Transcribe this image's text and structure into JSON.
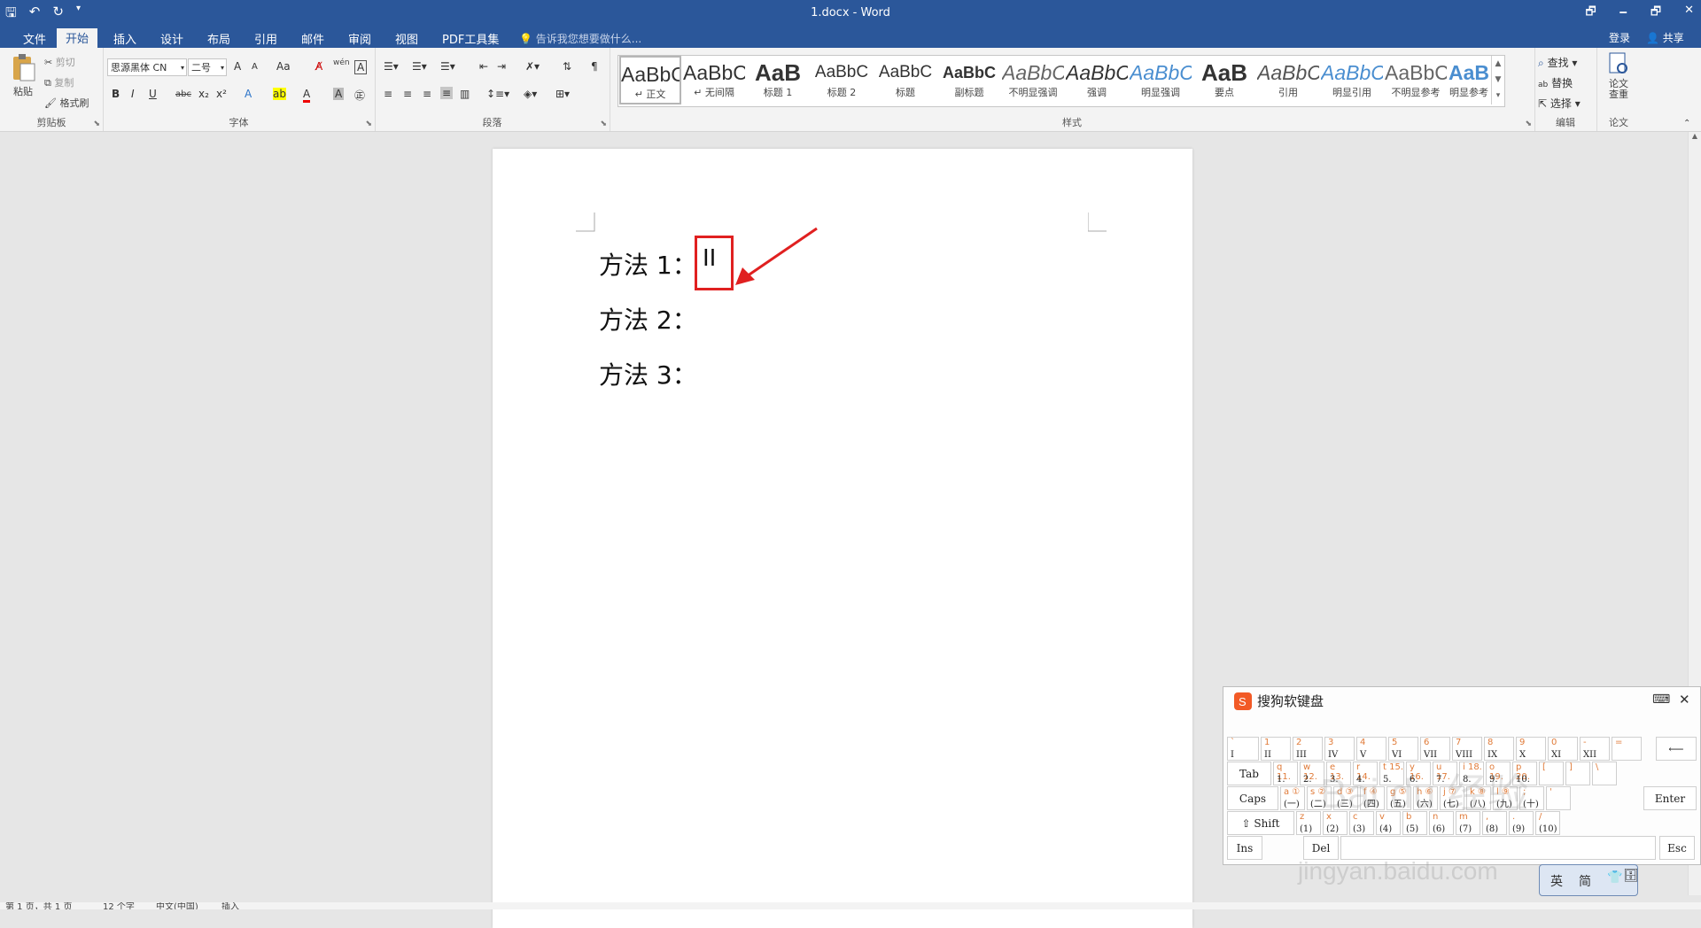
{
  "app": {
    "title": "1.docx - Word"
  },
  "qat": {
    "save": "🖫",
    "undo": "↶",
    "redo": "↻",
    "more": "▾"
  },
  "window": {
    "restore": "🗗",
    "minimize": "🗕",
    "maximize": "🗗",
    "close": "✕"
  },
  "tabs": [
    "文件",
    "开始",
    "插入",
    "设计",
    "布局",
    "引用",
    "邮件",
    "审阅",
    "视图",
    "PDF工具集"
  ],
  "tell_me": "告诉我您想要做什么...",
  "account": {
    "login": "登录",
    "share": "共享"
  },
  "clipboard": {
    "paste": "粘贴",
    "cut": "剪切",
    "copy": "复制",
    "format_painter": "格式刷",
    "label": "剪贴板"
  },
  "font": {
    "name": "思源黑体 CN",
    "size": "二号",
    "label": "字体",
    "bold": "B",
    "italic": "I",
    "underline": "U",
    "strike": "abc",
    "sub": "x₂",
    "sup": "x²",
    "grow": "A",
    "shrink": "A",
    "case": "Aa",
    "phonetic": "wén",
    "char_border": "A"
  },
  "paragraph": {
    "label": "段落"
  },
  "styles": {
    "label": "样式",
    "items": [
      {
        "preview": "AaBbCcDd",
        "label": "↵ 正文"
      },
      {
        "preview": "AaBbCcDd",
        "label": "↵ 无间隔"
      },
      {
        "preview": "AaB",
        "label": "标题 1"
      },
      {
        "preview": "AaBbC",
        "label": "标题 2"
      },
      {
        "preview": "AaBbC",
        "label": "标题"
      },
      {
        "preview": "AaBbC",
        "label": "副标题"
      },
      {
        "preview": "AaBbCcDd",
        "label": "不明显强调"
      },
      {
        "preview": "AaBbCcDd",
        "label": "强调"
      },
      {
        "preview": "AaBbCcDd",
        "label": "明显强调"
      },
      {
        "preview": "AaB",
        "label": "要点"
      },
      {
        "preview": "AaBbCcDd",
        "label": "引用"
      },
      {
        "preview": "AaBbCcDd",
        "label": "明显引用"
      },
      {
        "preview": "AaBbCcDd",
        "label": "不明显参考"
      },
      {
        "preview": "AaBbCcDd",
        "label": "明显参考"
      }
    ]
  },
  "editing": {
    "find": "查找",
    "replace": "替换",
    "select": "选择",
    "label": "编辑"
  },
  "paper": {
    "check": "论文查重",
    "check_line1": "论文",
    "check_line2": "查重",
    "label": "论文"
  },
  "document": {
    "lines": [
      "方法 1：",
      "方法 2：",
      "方法 3："
    ],
    "highlight_text": "II"
  },
  "status": {
    "page": "第 1 页，共 1 页",
    "words": "12 个字",
    "lang": "中文(中国)",
    "mode": "插入"
  },
  "keyboard": {
    "title": "搜狗软键盘",
    "row1": [
      [
        "`",
        "I"
      ],
      [
        "1",
        "II"
      ],
      [
        "2",
        "III"
      ],
      [
        "3",
        "IV"
      ],
      [
        "4",
        "V"
      ],
      [
        "5",
        "VI"
      ],
      [
        "6",
        "VII"
      ],
      [
        "7",
        "VIII"
      ],
      [
        "8",
        "IX"
      ],
      [
        "9",
        "X"
      ],
      [
        "0",
        "XI"
      ],
      [
        "-",
        "XII"
      ],
      [
        "=",
        ""
      ]
    ],
    "row2": [
      [
        "q 11.",
        "1."
      ],
      [
        "w 12.",
        "2."
      ],
      [
        "e 13.",
        "3."
      ],
      [
        "r 14.",
        "4."
      ],
      [
        "t 15.",
        "5."
      ],
      [
        "y 16.",
        "6."
      ],
      [
        "u 17.",
        "7."
      ],
      [
        "i 18.",
        "8."
      ],
      [
        "o 19.",
        "9."
      ],
      [
        "p 20.",
        "10."
      ],
      [
        "[",
        ""
      ],
      [
        "]",
        ""
      ],
      [
        "\\",
        ""
      ]
    ],
    "row3": [
      [
        "a ①",
        "(一)"
      ],
      [
        "s ②",
        "(二)"
      ],
      [
        "d ③",
        "(三)"
      ],
      [
        "f ④",
        "(四)"
      ],
      [
        "g ⑤",
        "(五)"
      ],
      [
        "h ⑥",
        "(六)"
      ],
      [
        "j ⑦",
        "(七)"
      ],
      [
        "k ⑧",
        "(八)"
      ],
      [
        "l ⑨",
        "(九)"
      ],
      [
        ";",
        "(十)"
      ],
      [
        "'",
        ""
      ]
    ],
    "row4": [
      [
        "z",
        "(1)"
      ],
      [
        "x",
        "(2)"
      ],
      [
        "c",
        "(3)"
      ],
      [
        "v",
        "(4)"
      ],
      [
        "b",
        "(5)"
      ],
      [
        "n",
        "(6)"
      ],
      [
        "m",
        "(7)"
      ],
      [
        ",",
        "(8)"
      ],
      [
        ".",
        "(9)"
      ],
      [
        "/",
        "(10)"
      ]
    ],
    "tab": "Tab",
    "caps": "Caps",
    "shift": "⇧ Shift",
    "ins": "Ins",
    "del": "Del",
    "enter": "Enter",
    "esc": "Esc",
    "back": "⟵"
  },
  "ime": {
    "lang": "英",
    "mode": "简"
  },
  "watermark": {
    "main": "Bai du 经验",
    "url": "jingyan.baidu.com"
  }
}
